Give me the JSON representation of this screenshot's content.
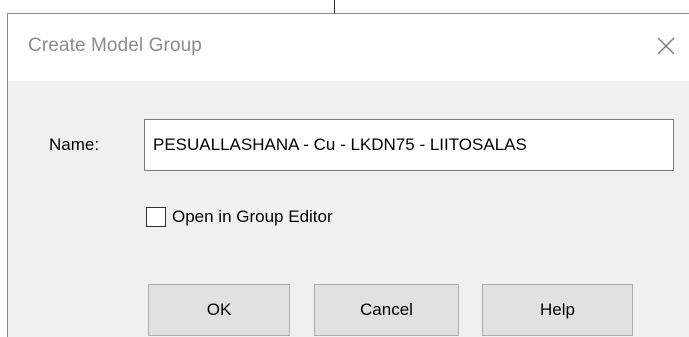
{
  "dialog": {
    "title": "Create Model Group",
    "close_icon": "close-x-icon"
  },
  "form": {
    "name_label": "Name:",
    "name_value": "PESUALLASHANA - Cu - LKDN75 - LIITOSALAS",
    "open_in_group_editor_label": "Open in Group Editor",
    "open_in_group_editor_checked": false
  },
  "buttons": {
    "ok_label": "OK",
    "cancel_label": "Cancel",
    "help_label": "Help"
  }
}
